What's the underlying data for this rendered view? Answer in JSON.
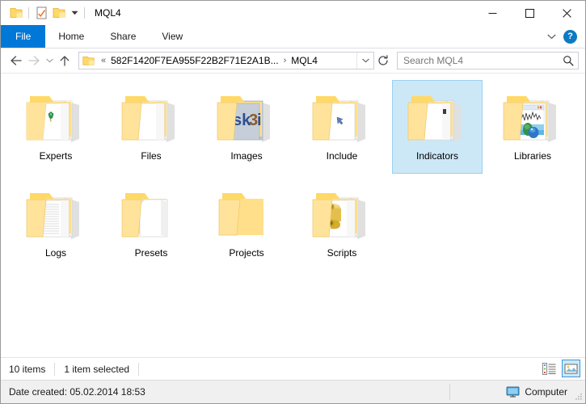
{
  "window": {
    "title": "MQL4",
    "quick_access": [
      {
        "name": "folder-icon",
        "label": "Folder"
      },
      {
        "name": "properties-icon",
        "label": "Properties"
      },
      {
        "name": "new-folder-icon",
        "label": "New folder"
      },
      {
        "name": "customize-quick-access-arrow",
        "label": "Customize Quick Access Toolbar"
      }
    ],
    "controls": {
      "minimize": "–",
      "maximize": "□",
      "close": "✕"
    }
  },
  "ribbon": {
    "tabs": [
      {
        "label": "File",
        "active": true
      },
      {
        "label": "Home",
        "active": false
      },
      {
        "label": "Share",
        "active": false
      },
      {
        "label": "View",
        "active": false
      }
    ],
    "minimize_ribbon_icon": "chevron-down-icon",
    "help_label": "?"
  },
  "address": {
    "back_icon": "←",
    "forward_icon": "→",
    "recent_icon": "⌄",
    "up_icon": "↑",
    "overflow": "«",
    "crumbs": [
      "582F1420F7EA955F22B2F71E2A1B...",
      "MQL4"
    ],
    "separator": "›",
    "dropdown_icon": "chevron-down-icon",
    "refresh_icon": "refresh-icon"
  },
  "search": {
    "placeholder": "Search MQL4",
    "value": "",
    "icon": "search-icon"
  },
  "files": {
    "items": [
      {
        "name": "Experts",
        "icon": "folder-documents-gem",
        "selected": false
      },
      {
        "name": "Files",
        "icon": "folder-documents",
        "selected": false
      },
      {
        "name": "Images",
        "icon": "folder-thumbnail-img",
        "selected": false
      },
      {
        "name": "Include",
        "icon": "folder-document-blue",
        "selected": false
      },
      {
        "name": "Indicators",
        "icon": "folder-documents",
        "selected": true
      },
      {
        "name": "Libraries",
        "icon": "folder-thumbnail-chart",
        "selected": false
      },
      {
        "name": "Logs",
        "icon": "folder-text-docs",
        "selected": false
      },
      {
        "name": "Presets",
        "icon": "folder-blank-doc",
        "selected": false
      },
      {
        "name": "Projects",
        "icon": "folder-empty",
        "selected": false
      },
      {
        "name": "Scripts",
        "icon": "folder-scroll",
        "selected": false
      }
    ]
  },
  "status": {
    "item_count": "10 items",
    "selection": "1 item selected",
    "views": [
      {
        "name": "details-view-button",
        "label": "Details view",
        "active": false
      },
      {
        "name": "large-icons-view-button",
        "label": "Large icons view",
        "active": true
      }
    ]
  },
  "details_pane": {
    "date_created_label": "Date created:",
    "date_created_value": "05.02.2014 18:53",
    "date_created_full": "Date created: 05.02.2014 18:53",
    "location_icon": "computer-icon",
    "location_label": "Computer"
  },
  "colors": {
    "accent": "#0078d7",
    "selection_fill": "#cce8f7",
    "selection_border": "#99d1f0",
    "folder_yellow": "#ffd966",
    "help_blue": "#0e7ac4",
    "details_bg": "#f0f0f0"
  }
}
